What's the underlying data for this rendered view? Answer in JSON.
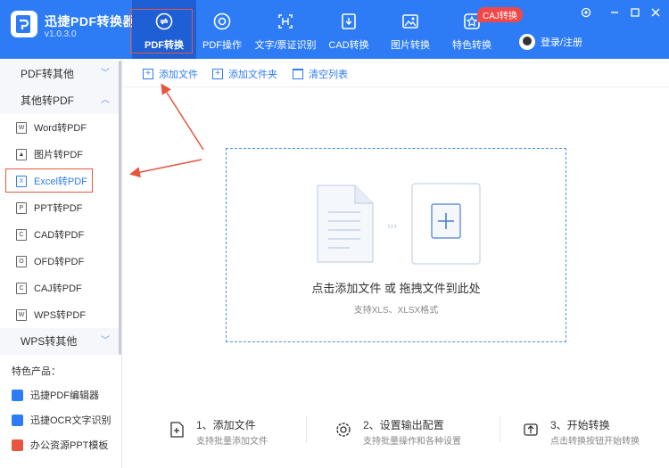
{
  "app": {
    "title": "迅捷PDF转换器",
    "version": "v1.0.3.0"
  },
  "nav": [
    {
      "label": "PDF转换",
      "icon": "pdf-convert-icon",
      "active": true
    },
    {
      "label": "PDF操作",
      "icon": "pdf-operate-icon"
    },
    {
      "label": "文字/票证识别",
      "icon": "ocr-icon"
    },
    {
      "label": "CAD转换",
      "icon": "cad-icon"
    },
    {
      "label": "图片转换",
      "icon": "image-icon"
    },
    {
      "label": "特色转换",
      "icon": "special-icon"
    }
  ],
  "caj_badge": "CAJ转换",
  "login": {
    "label": "登录/注册"
  },
  "window_controls": [
    "gear-icon",
    "minimize-icon",
    "maximize-icon",
    "close-icon"
  ],
  "sidebar": {
    "groups": [
      {
        "label": "PDF转其他",
        "expanded": false
      },
      {
        "label": "其他转PDF",
        "expanded": true
      },
      {
        "label": "WPS转其他",
        "expanded": false
      }
    ],
    "items": [
      {
        "label": "Word转PDF",
        "icon": "W"
      },
      {
        "label": "图片转PDF",
        "icon": "▲"
      },
      {
        "label": "Excel转PDF",
        "icon": "X",
        "selected": true
      },
      {
        "label": "PPT转PDF",
        "icon": "P"
      },
      {
        "label": "CAD转PDF",
        "icon": "C"
      },
      {
        "label": "OFD转PDF",
        "icon": "O"
      },
      {
        "label": "CAJ转PDF",
        "icon": "C"
      },
      {
        "label": "WPS转PDF",
        "icon": "W"
      }
    ],
    "featured_title": "特色产品：",
    "featured": [
      {
        "label": "迅捷PDF编辑器",
        "color": "#2d7cf6"
      },
      {
        "label": "迅捷OCR文字识别",
        "color": "#2d7cf6"
      },
      {
        "label": "办公资源PPT模板",
        "color": "#e8563f"
      }
    ]
  },
  "toolbar": {
    "add_file": "添加文件",
    "add_folder": "添加文件夹",
    "clear_list": "清空列表"
  },
  "dropzone": {
    "title": "点击添加文件 或 拖拽文件到此处",
    "subtitle": "支持XLS、XLSX格式"
  },
  "steps": [
    {
      "title": "1、添加文件",
      "desc": "支持批量添加文件",
      "icon": "add-file-icon"
    },
    {
      "title": "2、设置输出配置",
      "desc": "支持批量操作和各种设置",
      "icon": "settings-icon"
    },
    {
      "title": "3、开始转换",
      "desc": "点击转换按钮开始转换",
      "icon": "convert-icon"
    }
  ],
  "colors": {
    "accent": "#2d7cf6",
    "annotation": "#e8563f"
  }
}
